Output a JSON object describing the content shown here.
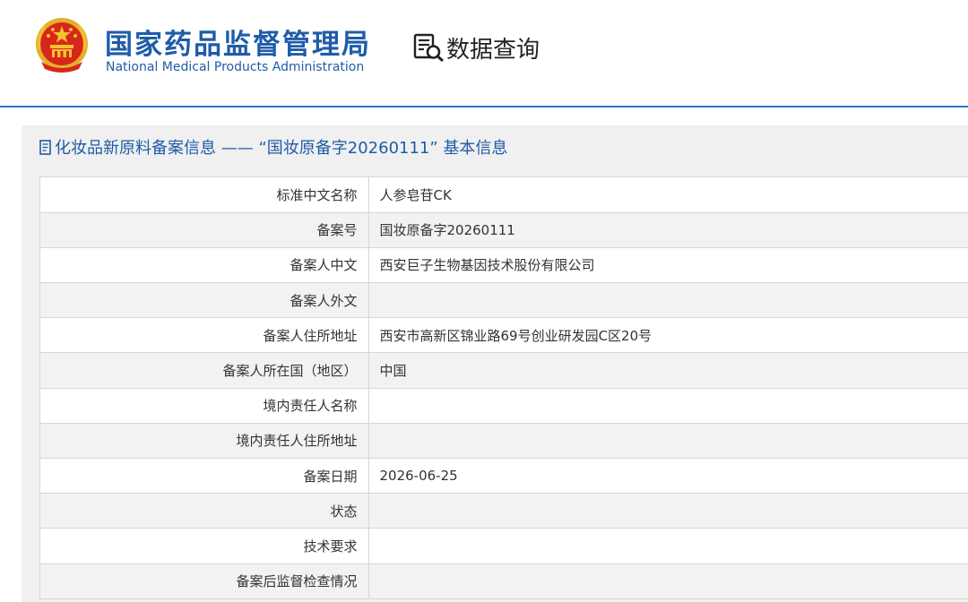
{
  "header": {
    "org_name_cn": "国家药品监督管理局",
    "org_name_en": "National Medical Products Administration",
    "query_label": "数据查询",
    "emblem_icon": "national-emblem-icon",
    "query_icon": "document-search-icon"
  },
  "panel": {
    "title": "化妆品新原料备案信息 —— “国妆原备字20260111” 基本信息",
    "title_icon": "document-icon"
  },
  "table": {
    "rows": [
      {
        "label": "标准中文名称",
        "value": "人参皂苷CK"
      },
      {
        "label": "备案号",
        "value": "国妆原备字20260111"
      },
      {
        "label": "备案人中文",
        "value": "西安巨子生物基因技术股份有限公司"
      },
      {
        "label": "备案人外文",
        "value": ""
      },
      {
        "label": "备案人住所地址",
        "value": "西安市高新区锦业路69号创业研发园C区20号"
      },
      {
        "label": "备案人所在国（地区）",
        "value": "中国"
      },
      {
        "label": "境内责任人名称",
        "value": ""
      },
      {
        "label": "境内责任人住所地址",
        "value": ""
      },
      {
        "label": "备案日期",
        "value": "2026-06-25"
      },
      {
        "label": "状态",
        "value": ""
      },
      {
        "label": "技术要求",
        "value": ""
      },
      {
        "label": "备案后监督检查情况",
        "value": ""
      }
    ]
  },
  "colors": {
    "brand_blue": "#1f5ca8",
    "rule_blue": "#2a78c8",
    "emblem_red": "#d8261c",
    "emblem_gold": "#f2c230"
  }
}
